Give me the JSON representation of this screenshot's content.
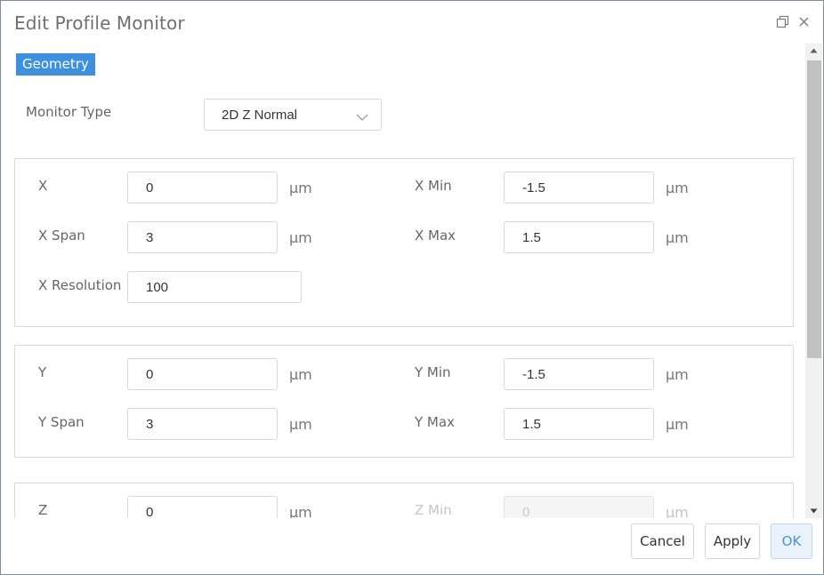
{
  "dialog": {
    "title": "Edit Profile Monitor"
  },
  "tabs": [
    {
      "label": "Geometry",
      "active": true
    }
  ],
  "monitor_type": {
    "label": "Monitor Type",
    "selected": "2D Z Normal"
  },
  "x_group": {
    "x": {
      "label": "X",
      "value": "0",
      "unit": "μm"
    },
    "x_span": {
      "label": "X Span",
      "value": "3",
      "unit": "μm"
    },
    "x_resolution": {
      "label": "X Resolution",
      "value": "100"
    },
    "x_min": {
      "label": "X Min",
      "value": "-1.5",
      "unit": "μm"
    },
    "x_max": {
      "label": "X Max",
      "value": "1.5",
      "unit": "μm"
    }
  },
  "y_group": {
    "y": {
      "label": "Y",
      "value": "0",
      "unit": "μm"
    },
    "y_span": {
      "label": "Y Span",
      "value": "3",
      "unit": "μm"
    },
    "y_min": {
      "label": "Y Min",
      "value": "-1.5",
      "unit": "μm"
    },
    "y_max": {
      "label": "Y Max",
      "value": "1.5",
      "unit": "μm"
    }
  },
  "z_group": {
    "z": {
      "label": "Z",
      "value": "0",
      "unit": "μm"
    },
    "z_min": {
      "label": "Z Min",
      "value": "0",
      "unit": "μm",
      "disabled": true
    }
  },
  "footer": {
    "cancel_label": "Cancel",
    "apply_label": "Apply",
    "ok_label": "OK"
  },
  "colors": {
    "accent": "#3d8fe0",
    "border": "#d9d9d9",
    "ok_background": "#eaf3fc"
  },
  "icons": {
    "restore": "restore-window-icon",
    "close": "close-icon",
    "dropdown": "chevron-down-icon",
    "scroll_up": "scroll-up-arrow-icon",
    "scroll_down": "scroll-down-arrow-icon"
  }
}
